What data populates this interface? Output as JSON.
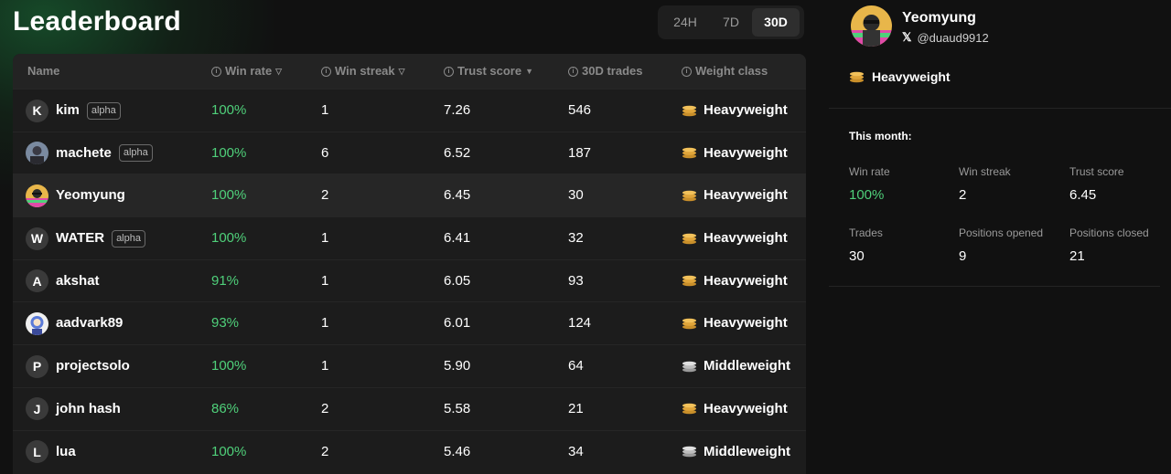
{
  "page": {
    "title": "Leaderboard",
    "periods": [
      "24H",
      "7D",
      "30D"
    ],
    "selected_period": "30D"
  },
  "table": {
    "headers": {
      "name": "Name",
      "win_rate": "Win rate",
      "win_streak": "Win streak",
      "trust_score": "Trust score",
      "trades": "30D trades",
      "weight_class": "Weight class"
    },
    "rows": [
      {
        "initial": "K",
        "avatar": "letter",
        "name": "kim",
        "badge": "alpha",
        "win_rate": "100%",
        "win_streak": "1",
        "trust_score": "7.26",
        "trades": "546",
        "weight_class": "Heavyweight",
        "weight_icon": "gold-coins-icon"
      },
      {
        "initial": "",
        "avatar": "photo",
        "name": "machete",
        "badge": "alpha",
        "win_rate": "100%",
        "win_streak": "6",
        "trust_score": "6.52",
        "trades": "187",
        "weight_class": "Heavyweight",
        "weight_icon": "gold-coins-icon"
      },
      {
        "initial": "",
        "avatar": "photo",
        "name": "Yeomyung",
        "badge": "",
        "win_rate": "100%",
        "win_streak": "2",
        "trust_score": "6.45",
        "trades": "30",
        "weight_class": "Heavyweight",
        "weight_icon": "gold-coins-icon",
        "selected": true
      },
      {
        "initial": "W",
        "avatar": "letter",
        "name": "WATER",
        "badge": "alpha",
        "win_rate": "100%",
        "win_streak": "1",
        "trust_score": "6.41",
        "trades": "32",
        "weight_class": "Heavyweight",
        "weight_icon": "gold-coins-icon"
      },
      {
        "initial": "A",
        "avatar": "letter",
        "name": "akshat",
        "badge": "",
        "win_rate": "91%",
        "win_streak": "1",
        "trust_score": "6.05",
        "trades": "93",
        "weight_class": "Heavyweight",
        "weight_icon": "gold-coins-icon"
      },
      {
        "initial": "",
        "avatar": "photo",
        "name": "aadvark89",
        "badge": "",
        "win_rate": "93%",
        "win_streak": "1",
        "trust_score": "6.01",
        "trades": "124",
        "weight_class": "Heavyweight",
        "weight_icon": "gold-coins-icon"
      },
      {
        "initial": "P",
        "avatar": "letter",
        "name": "projectsolo",
        "badge": "",
        "win_rate": "100%",
        "win_streak": "1",
        "trust_score": "5.90",
        "trades": "64",
        "weight_class": "Middleweight",
        "weight_icon": "silver-coins-icon"
      },
      {
        "initial": "J",
        "avatar": "letter",
        "name": "john hash",
        "badge": "",
        "win_rate": "86%",
        "win_streak": "2",
        "trust_score": "5.58",
        "trades": "21",
        "weight_class": "Heavyweight",
        "weight_icon": "gold-coins-icon"
      },
      {
        "initial": "L",
        "avatar": "letter",
        "name": "lua",
        "badge": "",
        "win_rate": "100%",
        "win_streak": "2",
        "trust_score": "5.46",
        "trades": "34",
        "weight_class": "Middleweight",
        "weight_icon": "silver-coins-icon"
      }
    ]
  },
  "profile": {
    "name": "Yeomyung",
    "handle": "@duaud9912",
    "weight_class": "Heavyweight",
    "month_label": "This month:",
    "stats": [
      {
        "label": "Win rate",
        "value": "100%"
      },
      {
        "label": "Win streak",
        "value": "2"
      },
      {
        "label": "Trust score",
        "value": "6.45"
      },
      {
        "label": "Trades",
        "value": "30"
      },
      {
        "label": "Positions opened",
        "value": "9"
      },
      {
        "label": "Positions closed",
        "value": "21"
      }
    ]
  },
  "colors": {
    "background": "#111111",
    "table_bg": "#1c1c1c",
    "header_bg": "#232323",
    "selected_row": "#262626",
    "win_green": "#4fd07a",
    "gold": "#e9b24a",
    "silver": "#cfcfcf"
  }
}
